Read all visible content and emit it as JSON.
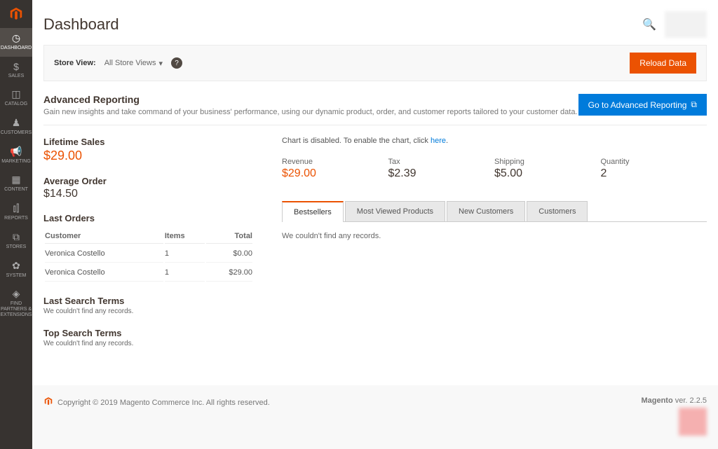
{
  "sidebar": {
    "items": [
      {
        "label": "Dashboard",
        "icon": "◷"
      },
      {
        "label": "Sales",
        "icon": "$"
      },
      {
        "label": "Catalog",
        "icon": "◫"
      },
      {
        "label": "Customers",
        "icon": "♟"
      },
      {
        "label": "Marketing",
        "icon": "📢"
      },
      {
        "label": "Content",
        "icon": "▦"
      },
      {
        "label": "Reports",
        "icon": "⫾⫿"
      },
      {
        "label": "Stores",
        "icon": "⧉"
      },
      {
        "label": "System",
        "icon": "✿"
      },
      {
        "label": "Find Partners & Extensions",
        "icon": "◈"
      }
    ]
  },
  "header": {
    "title": "Dashboard"
  },
  "scope": {
    "label": "Store View:",
    "selector": "All Store Views",
    "reload": "Reload Data"
  },
  "adv_reporting": {
    "title": "Advanced Reporting",
    "desc": "Gain new insights and take command of your business' performance, using our dynamic product, order, and customer reports tailored to your customer data.",
    "button": "Go to Advanced Reporting"
  },
  "lifetime_sales": {
    "title": "Lifetime Sales",
    "value": "$29.00"
  },
  "average_order": {
    "title": "Average Order",
    "value": "$14.50"
  },
  "last_orders": {
    "title": "Last Orders",
    "headers": {
      "customer": "Customer",
      "items": "Items",
      "total": "Total"
    },
    "rows": [
      {
        "customer": "Veronica Costello",
        "items": "1",
        "total": "$0.00"
      },
      {
        "customer": "Veronica Costello",
        "items": "1",
        "total": "$29.00"
      }
    ]
  },
  "last_search": {
    "title": "Last Search Terms",
    "empty": "We couldn't find any records."
  },
  "top_search": {
    "title": "Top Search Terms",
    "empty": "We couldn't find any records."
  },
  "chart_notice": {
    "prefix": "Chart is disabled. To enable the chart, click ",
    "link": "here",
    "suffix": "."
  },
  "stats": {
    "revenue": {
      "label": "Revenue",
      "value": "$29.00"
    },
    "tax": {
      "label": "Tax",
      "value": "$2.39"
    },
    "shipping": {
      "label": "Shipping",
      "value": "$5.00"
    },
    "quantity": {
      "label": "Quantity",
      "value": "2"
    }
  },
  "tabs": {
    "bestsellers": "Bestsellers",
    "most_viewed": "Most Viewed Products",
    "new_customers": "New Customers",
    "customers": "Customers",
    "empty": "We couldn't find any records."
  },
  "footer": {
    "copyright": "Copyright © 2019 Magento Commerce Inc. All rights reserved.",
    "brand": "Magento",
    "version": " ver. 2.2.5"
  }
}
